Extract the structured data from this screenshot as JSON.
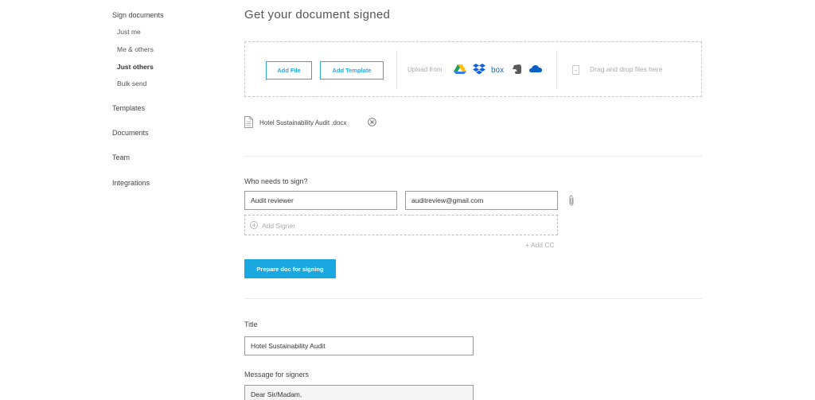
{
  "sidebar": {
    "sign_documents": "Sign documents",
    "sub_items": [
      "Just me",
      "Me & others",
      "Just others",
      "Bulk send"
    ],
    "templates": "Templates",
    "documents": "Documents",
    "team": "Team",
    "integrations": "Integrations"
  },
  "page": {
    "title": "Get your document signed"
  },
  "upload": {
    "add_file": "Add File",
    "add_template": "Add Template",
    "upload_from": "Upload from",
    "sources": [
      "google-drive-icon",
      "dropbox-icon",
      "box-icon",
      "evernote-icon",
      "onedrive-icon"
    ],
    "box_label": "box",
    "drag_drop": "Drag and drop files here"
  },
  "file": {
    "name": "Hotel Sustainability Audit .docx"
  },
  "signers": {
    "heading": "Who needs to sign?",
    "name_value": "Audit reviewer",
    "email_value": "auditreview@gmail.com",
    "add_signer": "Add Signer",
    "add_cc": "+ Add CC"
  },
  "actions": {
    "prepare": "Prepare doc for signing"
  },
  "doc_title": {
    "label": "Title",
    "value": "Hotel Sustainability Audit"
  },
  "message": {
    "label": "Message for signers",
    "value": "Dear Sir/Madam,"
  },
  "colors": {
    "accent": "#1aa8e0",
    "text": "#444444",
    "muted": "#aaaaaa"
  }
}
